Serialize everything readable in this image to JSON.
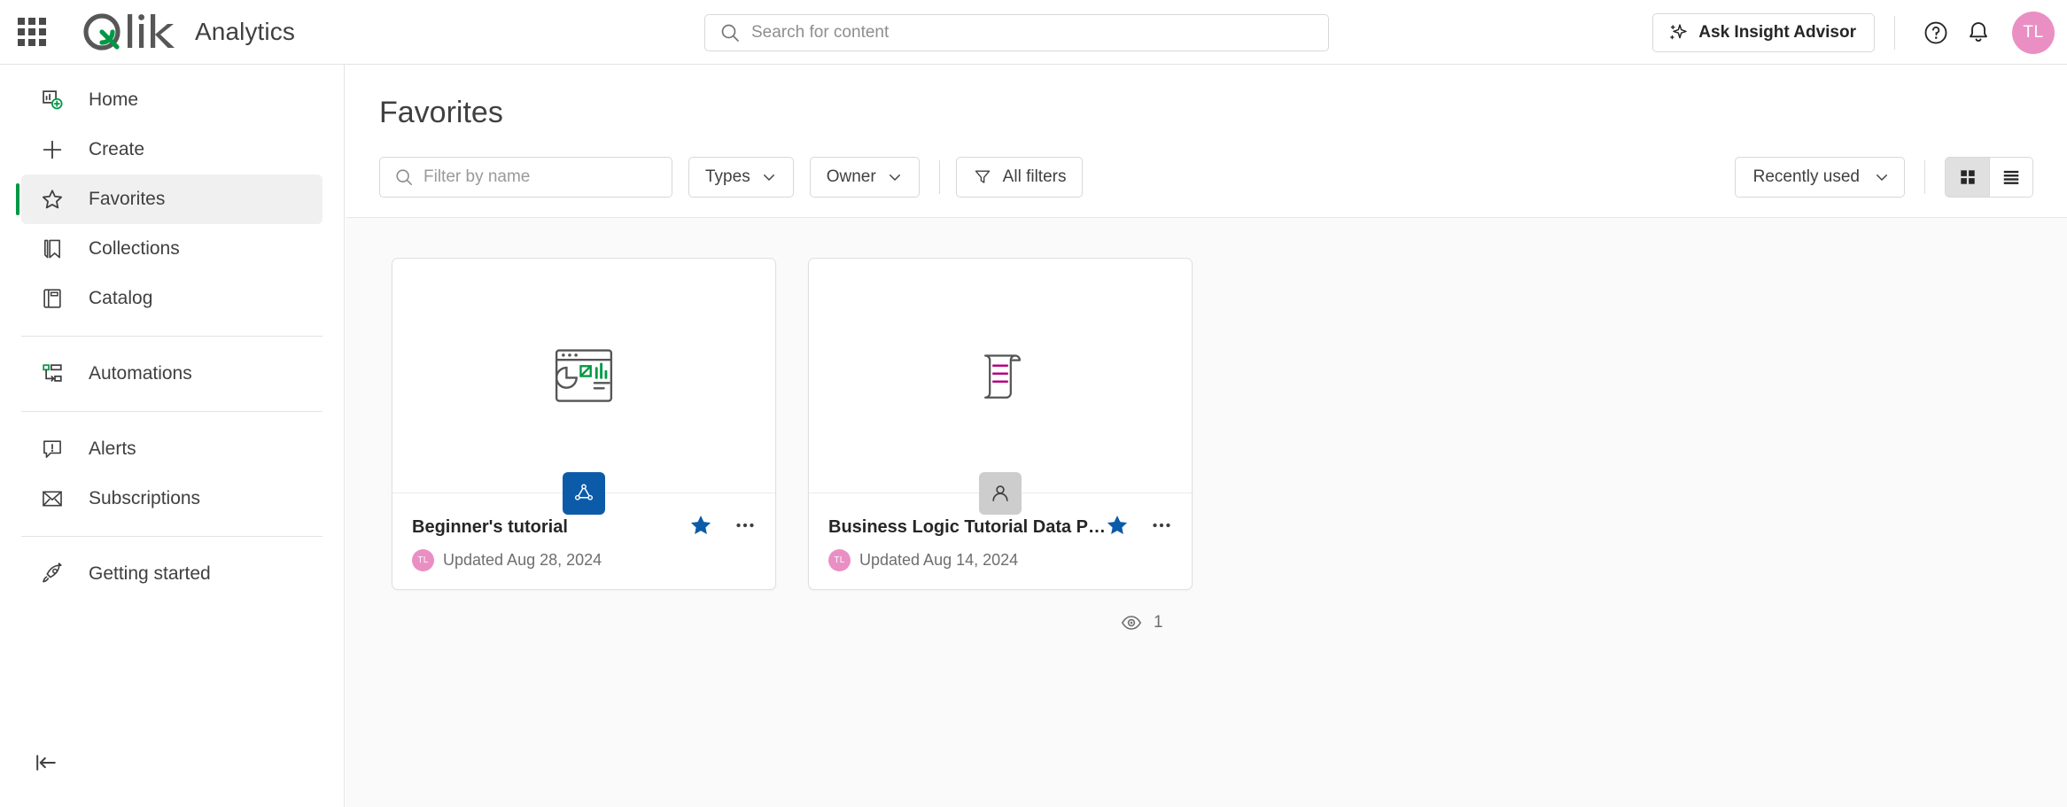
{
  "app": {
    "brand_name": "Qlik",
    "product_name": "Analytics",
    "accent_green": "#009845",
    "accent_blue": "#0c5ba9",
    "avatar_color": "#ea8fc4"
  },
  "topbar": {
    "launcher_icon": "app-launcher-grid-icon",
    "search": {
      "placeholder": "Search for content",
      "value": "",
      "icon": "search-icon"
    },
    "insight_advisor_label": "Ask Insight Advisor",
    "insight_advisor_icon": "sparkle-icon",
    "help_icon": "help-circle-icon",
    "notifications_icon": "bell-icon",
    "avatar_initials": "TL"
  },
  "sidebar": {
    "items": [
      {
        "label": "Home",
        "icon": "home-dashboard-icon",
        "active": false
      },
      {
        "label": "Create",
        "icon": "plus-icon",
        "active": false
      },
      {
        "label": "Favorites",
        "icon": "star-outline-icon",
        "active": true
      },
      {
        "label": "Collections",
        "icon": "bookmark-icon",
        "active": false
      },
      {
        "label": "Catalog",
        "icon": "catalog-book-icon",
        "active": false
      },
      {
        "label": "Automations",
        "icon": "automations-flow-icon",
        "active": false
      },
      {
        "label": "Alerts",
        "icon": "alert-bubble-icon",
        "active": false
      },
      {
        "label": "Subscriptions",
        "icon": "envelope-icon",
        "active": false
      },
      {
        "label": "Getting started",
        "icon": "rocket-icon",
        "active": false
      }
    ],
    "collapse_icon": "collapse-left-icon"
  },
  "main": {
    "page_title": "Favorites",
    "toolbar": {
      "filter_placeholder": "Filter by name",
      "filter_value": "",
      "filter_icon": "search-icon",
      "types_label": "Types",
      "owner_label": "Owner",
      "all_filters_label": "All filters",
      "all_filters_icon": "funnel-icon",
      "chevron_icon": "chevron-down-icon",
      "sort_label": "Recently used",
      "view_grid_icon": "grid-view-icon",
      "view_list_icon": "list-view-icon",
      "view_selected": "grid"
    },
    "cards": [
      {
        "title": "Beginner's tutorial",
        "date": "Updated Aug 28, 2024",
        "owner_initials": "TL",
        "thumb_icon": "analytics-app-chart-icon",
        "type_badge_icon": "qlik-sense-app-icon",
        "type_badge_style": "badge-app",
        "favorited": true,
        "star_icon": "star-filled-icon",
        "more_icon": "ellipsis-icon"
      },
      {
        "title": "Business Logic Tutorial Data Prep",
        "date": "Updated Aug 14, 2024",
        "owner_initials": "TL",
        "thumb_icon": "script-document-icon",
        "type_badge_icon": "person-icon",
        "type_badge_style": "badge-user",
        "favorited": true,
        "star_icon": "star-filled-icon",
        "more_icon": "ellipsis-icon"
      }
    ],
    "views": {
      "icon": "eye-icon",
      "count": "1"
    }
  }
}
